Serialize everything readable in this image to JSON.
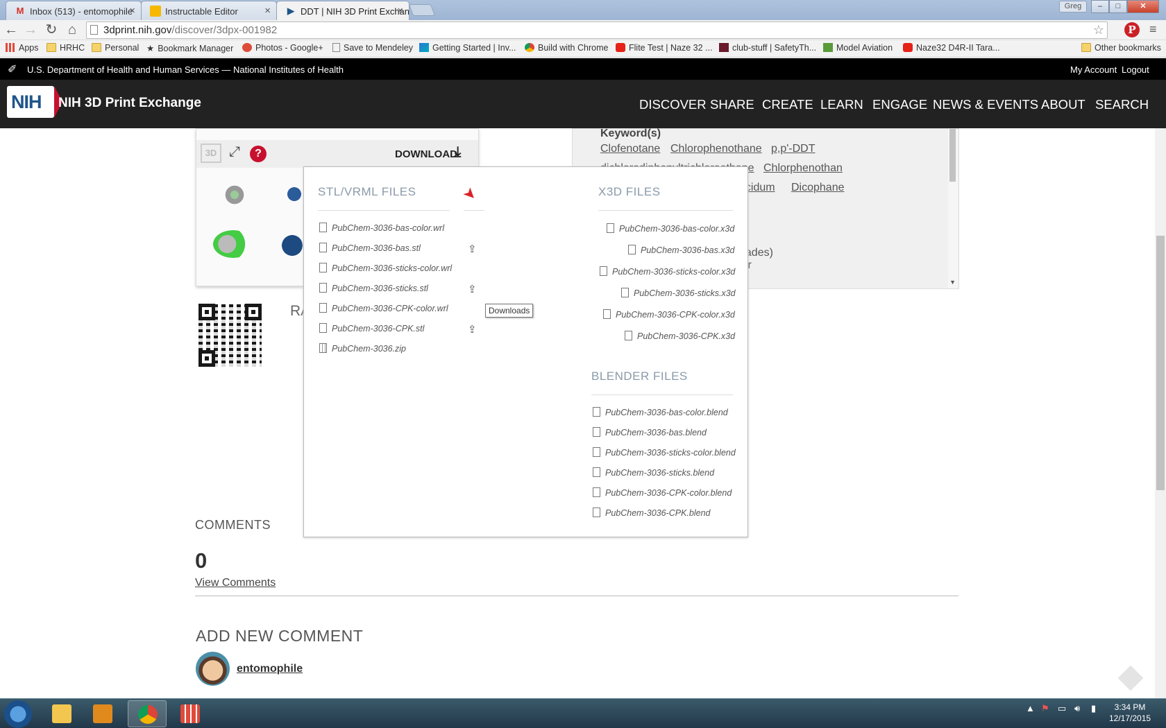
{
  "browser": {
    "tabs": [
      {
        "label": "Inbox (513) - entomophile",
        "favicon": "gmail-icon"
      },
      {
        "label": "Instructable Editor",
        "favicon": "instructables-icon"
      },
      {
        "label": "DDT | NIH 3D Print Exchan",
        "favicon": "nih-icon"
      }
    ],
    "profile": "Greg",
    "url_host": "3dprint.nih.gov",
    "url_path": "/discover/3dpx-001982",
    "bookmarks": [
      "Apps",
      "HRHC",
      "Personal",
      "Bookmark Manager",
      "Photos - Google+",
      "Save to Mendeley",
      "Getting Started | Inv...",
      "Build with Chrome",
      "Flite Test | Naze 32 ...",
      "club-stuff | SafetyTh...",
      "Model Aviation",
      "Naze32 D4R-II Tara..."
    ],
    "other_bookmarks": "Other bookmarks"
  },
  "header": {
    "hhs_text": "U.S. Department of Health and Human Services  —  National Institutes of Health",
    "my_account": "My Account",
    "logout": "Logout",
    "logo_text": "NIH",
    "site_title": "NIH 3D Print Exchange",
    "nav": [
      "DISCOVER",
      "SHARE",
      "CREATE",
      "LEARN",
      "ENGAGE",
      "NEWS & EVENTS",
      "ABOUT",
      "SEARCH"
    ]
  },
  "viewer": {
    "badge_3d": "3D",
    "help": "?",
    "download_label": "DOWNLOAD"
  },
  "rating_title": "RA",
  "metadata": {
    "keywords_title": "Keyword(s)",
    "keywords": [
      "Clofenotane",
      "Chlorophenothane",
      "p,p'-DDT",
      "dichlorodiphenyltrichloroethane",
      "Chlorphenothan",
      "ocidum",
      "Dicophane"
    ],
    "partial_1": "hades)",
    "partial_2": "lor"
  },
  "download_popup": {
    "stl_heading": "STL/VRML FILES",
    "x3d_heading": "X3D FILES",
    "blender_heading": "BLENDER FILES",
    "stl_files": [
      "PubChem-3036-bas-color.wrl",
      "PubChem-3036-bas.stl",
      "PubChem-3036-sticks-color.wrl",
      "PubChem-3036-sticks.stl",
      "PubChem-3036-CPK-color.wrl",
      "PubChem-3036-CPK.stl",
      "PubChem-3036.zip"
    ],
    "x3d_files": [
      "PubChem-3036-bas-color.x3d",
      "PubChem-3036-bas.x3d",
      "PubChem-3036-sticks-color.x3d",
      "PubChem-3036-sticks.x3d",
      "PubChem-3036-CPK-color.x3d",
      "PubChem-3036-CPK.x3d"
    ],
    "blender_files": [
      "PubChem-3036-bas-color.blend",
      "PubChem-3036-bas.blend",
      "PubChem-3036-sticks-color.blend",
      "PubChem-3036-sticks.blend",
      "PubChem-3036-CPK-color.blend",
      "PubChem-3036-CPK.blend"
    ],
    "tooltip": "Downloads"
  },
  "comments": {
    "title": "COMMENTS",
    "count": "0",
    "view_link": "View Comments",
    "add_title": "ADD NEW COMMENT",
    "username": "entomophile"
  },
  "taskbar": {
    "time": "3:34 PM",
    "date": "12/17/2015"
  },
  "colors": {
    "nih_blue": "#20558a",
    "nih_red": "#c8102e",
    "nav_bg": "#222222"
  }
}
